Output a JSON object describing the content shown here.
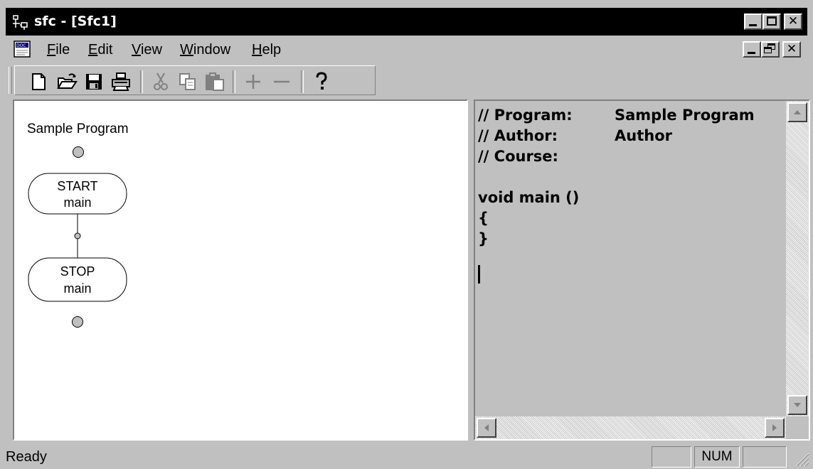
{
  "window": {
    "title": "sfc - [Sfc1]",
    "app_icon": "sfc-app-icon",
    "caption_buttons": [
      "minimize",
      "maximize",
      "close"
    ]
  },
  "menubar": {
    "doc_icon": "document-icon",
    "items": [
      {
        "label": "File",
        "mnemonic": "F"
      },
      {
        "label": "Edit",
        "mnemonic": "E"
      },
      {
        "label": "View",
        "mnemonic": "V"
      },
      {
        "label": "Window",
        "mnemonic": "W"
      },
      {
        "label": "Help",
        "mnemonic": "H"
      }
    ],
    "mdi_buttons": [
      "minimize",
      "restore",
      "close"
    ]
  },
  "toolbar": {
    "buttons": [
      {
        "name": "new-button",
        "icon": "new-document-icon",
        "enabled": true
      },
      {
        "name": "open-button",
        "icon": "open-folder-icon",
        "enabled": true
      },
      {
        "name": "save-button",
        "icon": "floppy-disk-icon",
        "enabled": true
      },
      {
        "name": "print-button",
        "icon": "printer-icon",
        "enabled": true
      },
      {
        "name": "cut-button",
        "icon": "scissors-icon",
        "enabled": false
      },
      {
        "name": "copy-button",
        "icon": "copy-icon",
        "enabled": false
      },
      {
        "name": "paste-button",
        "icon": "paste-icon",
        "enabled": false
      },
      {
        "name": "add-button",
        "icon": "plus-icon",
        "enabled": false
      },
      {
        "name": "remove-button",
        "icon": "minus-icon",
        "enabled": false
      },
      {
        "name": "help-button",
        "icon": "help-pointer-icon",
        "enabled": true
      }
    ]
  },
  "diagram": {
    "program_name": "Sample Program",
    "start_block": {
      "line1": "START",
      "line2": "main"
    },
    "stop_block": {
      "line1": "STOP",
      "line2": "main"
    }
  },
  "code_view": {
    "lines": [
      {
        "label": "// Program:",
        "value": "Sample Program"
      },
      {
        "label": "// Author:",
        "value": "Author"
      },
      {
        "label": "// Course:",
        "value": ""
      },
      {
        "label": "",
        "value": ""
      },
      {
        "label": "void main ()",
        "value": ""
      },
      {
        "label": "{",
        "value": ""
      },
      {
        "label": "}",
        "value": ""
      }
    ]
  },
  "statusbar": {
    "text": "Ready",
    "indicators": [
      "",
      "NUM",
      ""
    ]
  },
  "colors": {
    "titlebar": "#000000",
    "chrome": "#c0c0c0",
    "canvas": "#ffffff"
  }
}
